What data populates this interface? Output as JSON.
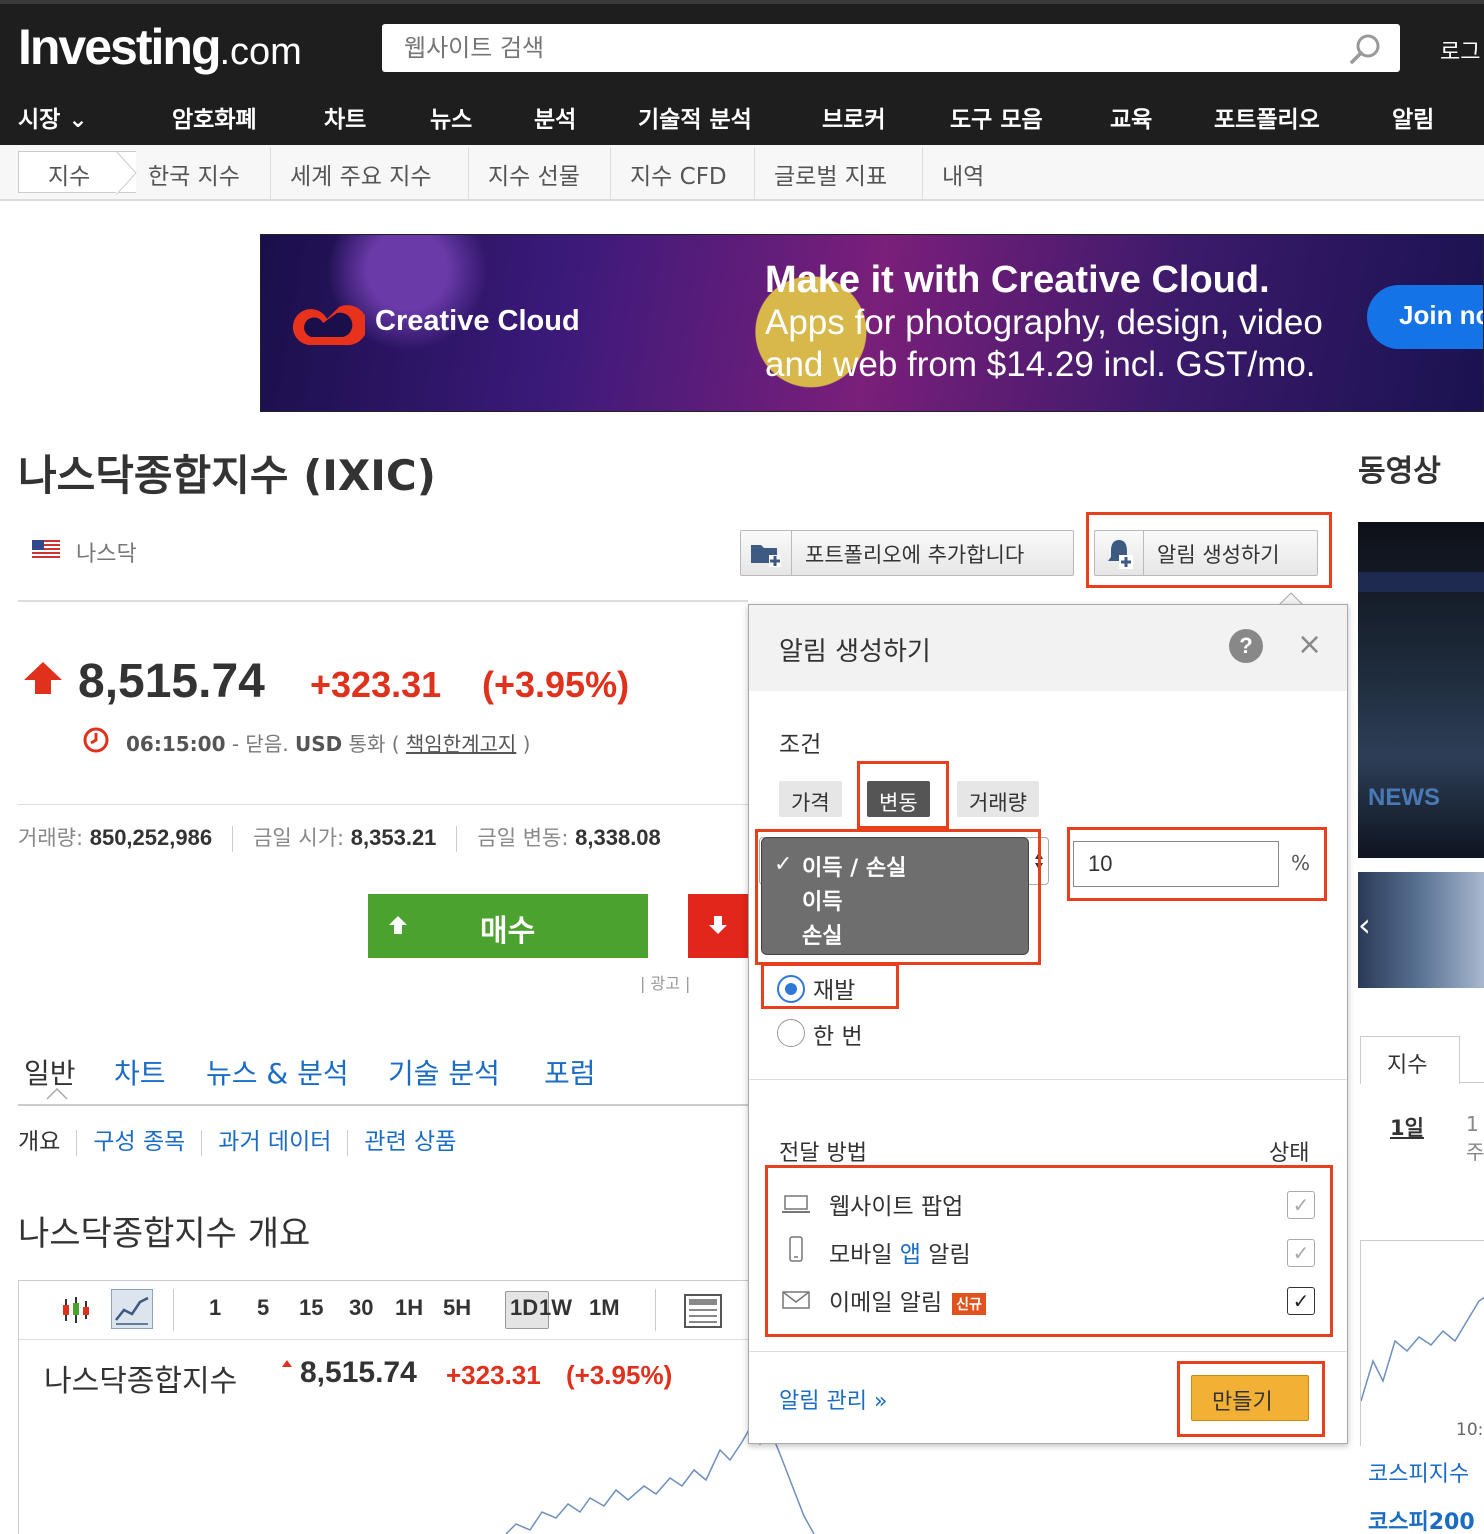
{
  "header": {
    "logo_main": "Investing",
    "logo_suffix": ".com",
    "search_placeholder": "웹사이트 검색",
    "login": "로그"
  },
  "main_nav": [
    "시장 ⌄",
    "암호화폐",
    "차트",
    "뉴스",
    "분석",
    "기술적 분석",
    "브로커",
    "도구 모음",
    "교육",
    "포트폴리오",
    "알림"
  ],
  "sub_nav": [
    "지수",
    "한국 지수",
    "세계 주요 지수",
    "지수 선물",
    "지수 CFD",
    "글로벌 지표",
    "내역"
  ],
  "banner": {
    "brand": "Creative Cloud",
    "headline": "Make it with Creative Cloud.",
    "line1": "Apps for photography, design, video",
    "line2": "and web from $14.29 incl. GST/mo.",
    "cta": "Join no"
  },
  "instrument": {
    "title": "나스닥종합지수 (IXIC)",
    "exchange": "나스닥",
    "add_portfolio": "포트폴리오에 추가합니다",
    "create_alert": "알림 생성하기",
    "price": "8,515.74",
    "change": "+323.31",
    "change_pct": "(+3.95%)",
    "time": "06:15:00",
    "time_status": " - 닫음. ",
    "currency": "USD",
    "currency_label": " 통화 ( ",
    "disclaimer": "책임한계고지",
    "close_paren": " )",
    "stats": [
      {
        "label": "거래량: ",
        "value": "850,252,986"
      },
      {
        "label": "금일 시가: ",
        "value": "8,353.21"
      },
      {
        "label": "금일 변동: ",
        "value": "8,338.08"
      }
    ],
    "buy_label": "매수",
    "ad_label": "| 광고 |"
  },
  "tabs": [
    "일반",
    "차트",
    "뉴스 & 분석",
    "기술 분석",
    "포럼"
  ],
  "subtabs": [
    "개요",
    "구성 종목",
    "과거 데이터",
    "관련 상품"
  ],
  "overview_title": "나스닥종합지수 개요",
  "chart_toolbar": {
    "timeframes": [
      "1",
      "5",
      "15",
      "30",
      "1H",
      "5H",
      "1D",
      "1W",
      "1M"
    ],
    "selected": "1D"
  },
  "chart_header": {
    "name": "나스닥종합지수",
    "price": "8,515.74",
    "change": "+323.31",
    "change_pct": "(+3.95%)"
  },
  "sidebar": {
    "videos_title": "동영상",
    "video_news": "NEWS",
    "tab": "지수",
    "period_1d": "1일",
    "period_1w": "1주",
    "time": "10:",
    "link1": "코스피지수",
    "link2": "코스피200"
  },
  "alert_popup": {
    "title": "알림 생성하기",
    "help": "?",
    "close": "×",
    "condition_label": "조건",
    "condition_tabs": [
      "가격",
      "변동",
      "거래량"
    ],
    "condition_active": "변동",
    "dropdown_options": [
      "이득 / 손실",
      "이득",
      "손실"
    ],
    "dropdown_selected": "이득 / 손실",
    "percent_value": "10",
    "percent_sign": "%",
    "frequency": [
      {
        "label": "재발",
        "selected": true
      },
      {
        "label": "한 번",
        "selected": false
      }
    ],
    "delivery_label": "전달 방법",
    "status_label": "상태",
    "delivery_methods": [
      {
        "label_pre": "웹사이트 팝업",
        "label_link": "",
        "label_post": "",
        "badge": "",
        "checked": false
      },
      {
        "label_pre": "모바일 ",
        "label_link": "앱",
        "label_post": " 알림",
        "badge": "",
        "checked": false
      },
      {
        "label_pre": "이메일 알림",
        "label_link": "",
        "label_post": "",
        "badge": "신규",
        "checked": true
      }
    ],
    "manage_link": "알림 관리 »",
    "create_button": "만들기"
  },
  "colors": {
    "header_bg": "#1e1e1e",
    "up_red": "#e0311c",
    "buy_green": "#4ca22f",
    "sell_red": "#e2261c",
    "link_blue": "#1a6cc4",
    "highlight": "#e8401c",
    "create_btn": "#f2b035"
  }
}
